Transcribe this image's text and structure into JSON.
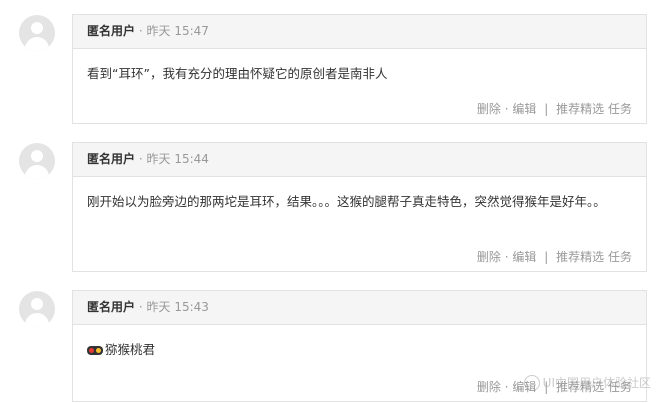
{
  "comments": [
    {
      "author": "匿名用户",
      "separator": "·",
      "time": "昨天 15:47",
      "text": "看到“耳环”，我有充分的理由怀疑它的原创者是南非人",
      "actions": {
        "delete": "删除",
        "dot": "·",
        "edit": "编辑",
        "divider": "|",
        "recommend": "推荐精选",
        "task": "任务"
      }
    },
    {
      "author": "匿名用户",
      "separator": "·",
      "time": "昨天 15:44",
      "text": "刚开始以为脸旁边的那两坨是耳环，结果。。。这猴的腿帮子真走特色，突然觉得猴年是好年。。",
      "actions": {
        "delete": "删除",
        "dot": "·",
        "edit": "编辑",
        "divider": "|",
        "recommend": "推荐精选",
        "task": "任务"
      }
    },
    {
      "author": "匿名用户",
      "separator": "·",
      "time": "昨天 15:43",
      "text": "猕猴桃君",
      "emoji_icon": "emoji-icon",
      "actions": {
        "delete": "删除",
        "dot": "·",
        "edit": "编辑",
        "divider": "|",
        "recommend": "推荐精选",
        "task": "任务"
      }
    }
  ],
  "watermark": {
    "text": "UI中国用户体验社区"
  },
  "colors": {
    "header_bg": "#f5f5f5",
    "border": "#e2e2e2",
    "muted_text": "#999999",
    "body_text": "#333333"
  }
}
